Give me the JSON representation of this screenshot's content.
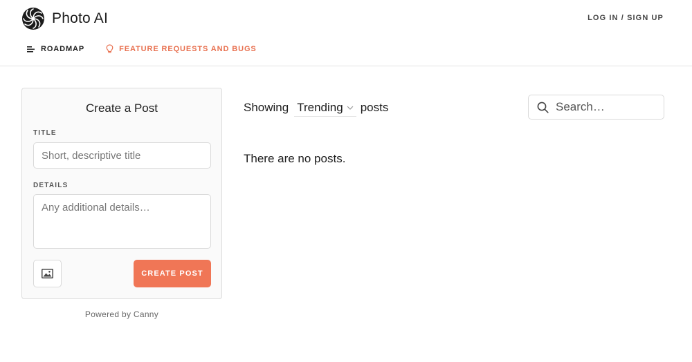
{
  "header": {
    "brand_name": "Photo AI",
    "login_label": "LOG IN / SIGN UP"
  },
  "nav": {
    "items": [
      {
        "label": "ROADMAP",
        "icon": "roadmap-icon"
      },
      {
        "label": "FEATURE REQUESTS AND BUGS",
        "icon": "lightbulb-icon"
      }
    ]
  },
  "create_post": {
    "title": "Create a Post",
    "title_label": "TITLE",
    "title_placeholder": "Short, descriptive title",
    "details_label": "DETAILS",
    "details_placeholder": "Any additional details…",
    "image_icon": "image-icon",
    "submit_label": "CREATE POST"
  },
  "powered_by": "Powered by Canny",
  "posts": {
    "showing_label": "Showing",
    "sort_value": "Trending",
    "posts_label": "posts",
    "search_placeholder": "Search…",
    "empty_message": "There are no posts."
  },
  "colors": {
    "accent": "#f07656",
    "feature_link": "#e8704f",
    "border": "#d9d9d9"
  }
}
